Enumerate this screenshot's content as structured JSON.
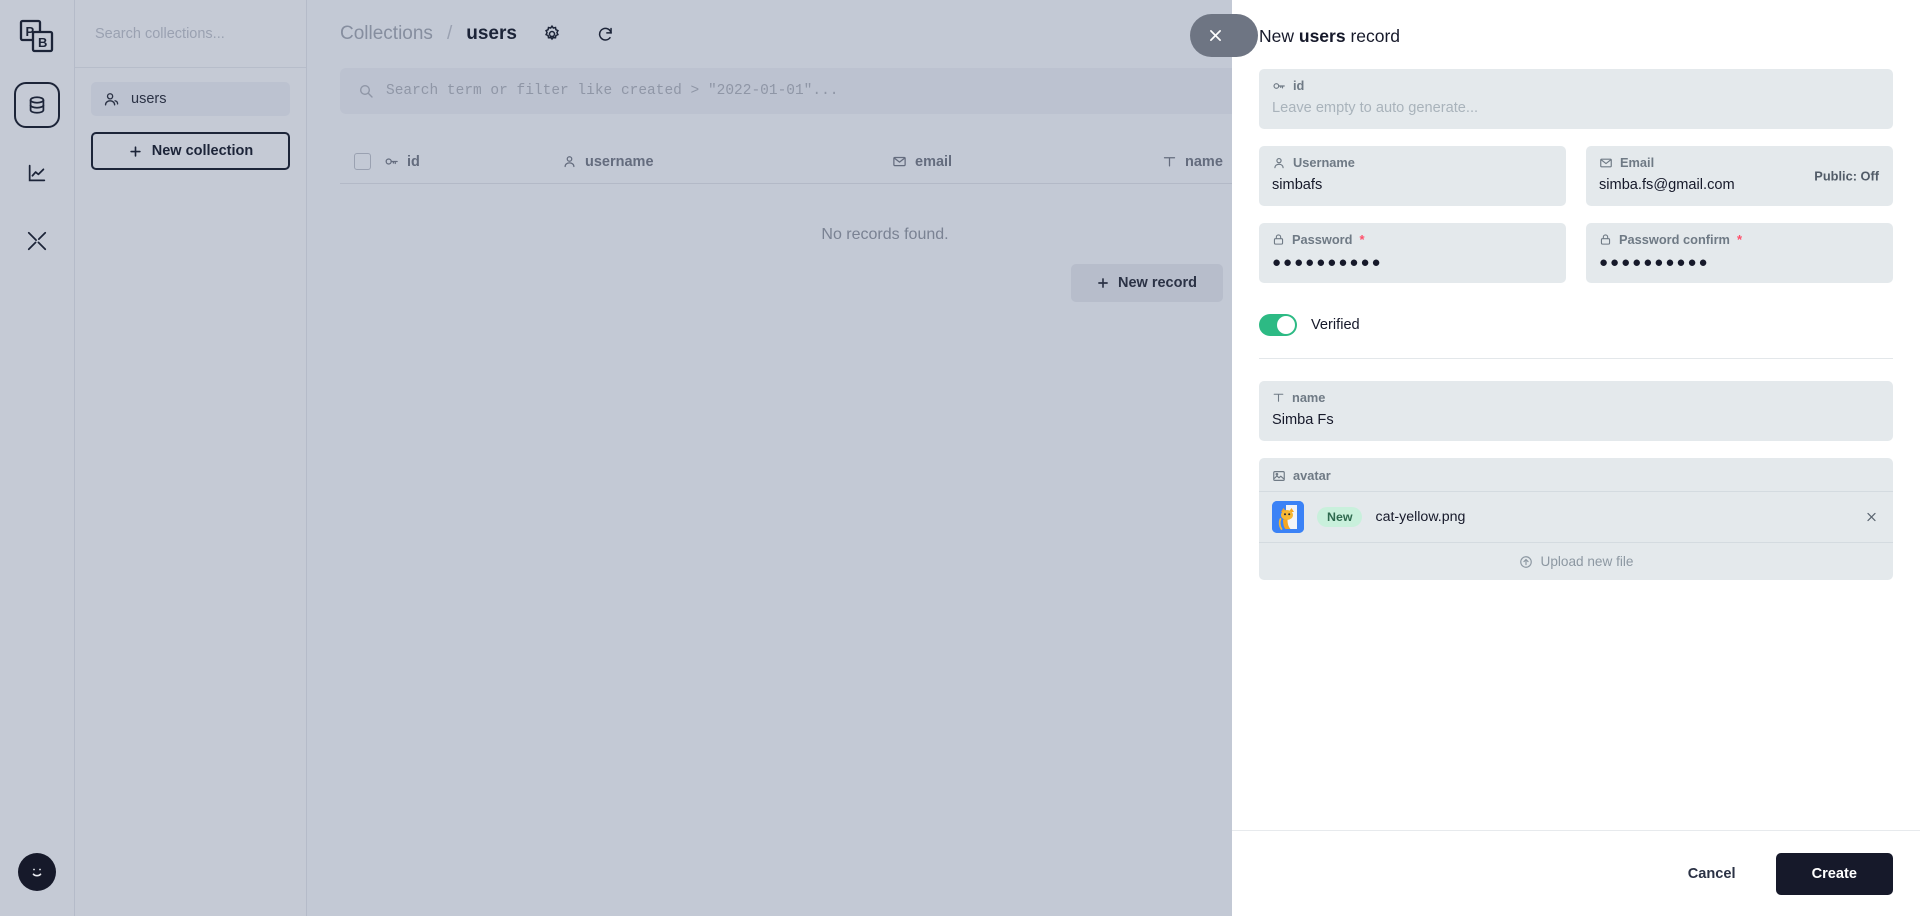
{
  "rail": {
    "logo": "pocketbase-logo",
    "items": [
      {
        "icon": "database-icon",
        "name": "collections",
        "active": true
      },
      {
        "icon": "chart-line-icon",
        "name": "logs",
        "active": false
      },
      {
        "icon": "tools-icon",
        "name": "settings",
        "active": false
      }
    ],
    "avatar_icon": "smiley-face-icon"
  },
  "sidebar": {
    "search_placeholder": "Search collections...",
    "items": [
      {
        "label": "users",
        "icon": "users-icon",
        "active": true
      }
    ],
    "new_collection_label": "New collection"
  },
  "header": {
    "breadcrumb_root": "Collections",
    "breadcrumb_sep": "/",
    "breadcrumb_current": "users",
    "gear_icon": "gear-icon",
    "refresh_icon": "refresh-icon"
  },
  "search": {
    "placeholder": "Search term or filter like created > \"2022-01-01\"...",
    "icon": "search-icon"
  },
  "table": {
    "columns": [
      {
        "label": "id",
        "icon": "key-icon"
      },
      {
        "label": "username",
        "icon": "user-icon"
      },
      {
        "label": "email",
        "icon": "mail-icon"
      },
      {
        "label": "name",
        "icon": "text-icon"
      }
    ],
    "empty_message": "No records found.",
    "new_record_label": "New record"
  },
  "panel": {
    "close_icon": "close-icon",
    "title_prefix": "New ",
    "title_bold": "users",
    "title_suffix": " record",
    "fields": {
      "id": {
        "label": "id",
        "icon": "key-icon",
        "placeholder": "Leave empty to auto generate...",
        "value": ""
      },
      "username": {
        "label": "Username",
        "icon": "user-icon",
        "value": "simbafs"
      },
      "email": {
        "label": "Email",
        "icon": "mail-icon",
        "value": "simba.fs@gmail.com",
        "public_label": "Public: Off"
      },
      "password": {
        "label": "Password",
        "icon": "lock-icon",
        "required": "*",
        "value": "●●●●●●●●●●"
      },
      "password_confirm": {
        "label": "Password confirm",
        "icon": "lock-icon",
        "required": "*",
        "value": "●●●●●●●●●●"
      },
      "verified": {
        "label": "Verified",
        "state": "on",
        "color": "#2dba84"
      },
      "name": {
        "label": "name",
        "icon": "text-icon",
        "value": "Simba Fs"
      },
      "avatar": {
        "label": "avatar",
        "icon": "image-icon",
        "file": {
          "badge": "New",
          "filename": "cat-yellow.png",
          "remove_icon": "close-icon",
          "thumbnail": "cat-yellow-thumbnail"
        },
        "upload_label": "Upload new file",
        "upload_icon": "upload-icon"
      }
    },
    "footer": {
      "cancel_label": "Cancel",
      "create_label": "Create"
    }
  }
}
